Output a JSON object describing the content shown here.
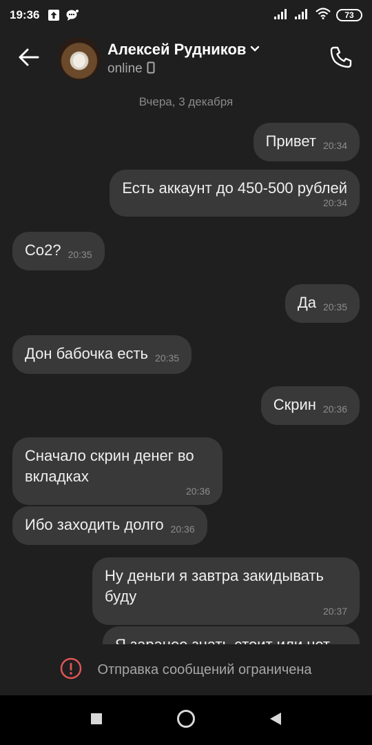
{
  "status_bar": {
    "time": "19:36",
    "battery": "73",
    "icons": [
      "upload-icon",
      "chat-notification-icon",
      "signal-icon",
      "signal-icon",
      "wifi-icon",
      "battery-icon"
    ]
  },
  "header": {
    "name": "Алексей Рудников",
    "status": "online",
    "icons": [
      "back-arrow-icon",
      "chevron-down-icon",
      "mobile-icon",
      "phone-icon"
    ]
  },
  "date_separator": "Вчера, 3 декабря",
  "messages": [
    {
      "dir": "out",
      "text": "Привет",
      "time": "20:34"
    },
    {
      "dir": "out",
      "text": "Есть аккаунт до 450-500 рублей",
      "time": "20:34"
    },
    {
      "dir": "in",
      "text": "Co2?",
      "time": "20:35"
    },
    {
      "dir": "out",
      "text": "Да",
      "time": "20:35"
    },
    {
      "dir": "in",
      "text": "Дон бабочка есть",
      "time": "20:35"
    },
    {
      "dir": "out",
      "text": "Скрин",
      "time": "20:36"
    },
    {
      "dir": "in",
      "text": "Сначало скрин денег во вкладках",
      "time": "20:36"
    },
    {
      "dir": "in",
      "text": "Ибо заходить долго",
      "time": "20:36"
    },
    {
      "dir": "out",
      "text": "Ну деньги я завтра закидывать буду",
      "time": "20:37"
    },
    {
      "dir": "out",
      "text": "Я заранее знать стоит или нет",
      "time": ""
    }
  ],
  "restricted": {
    "text": "Отправка сообщений ограничена",
    "color": "#e05555"
  },
  "nav": {
    "icons": [
      "recents-square-icon",
      "home-circle-icon",
      "back-triangle-icon"
    ]
  }
}
